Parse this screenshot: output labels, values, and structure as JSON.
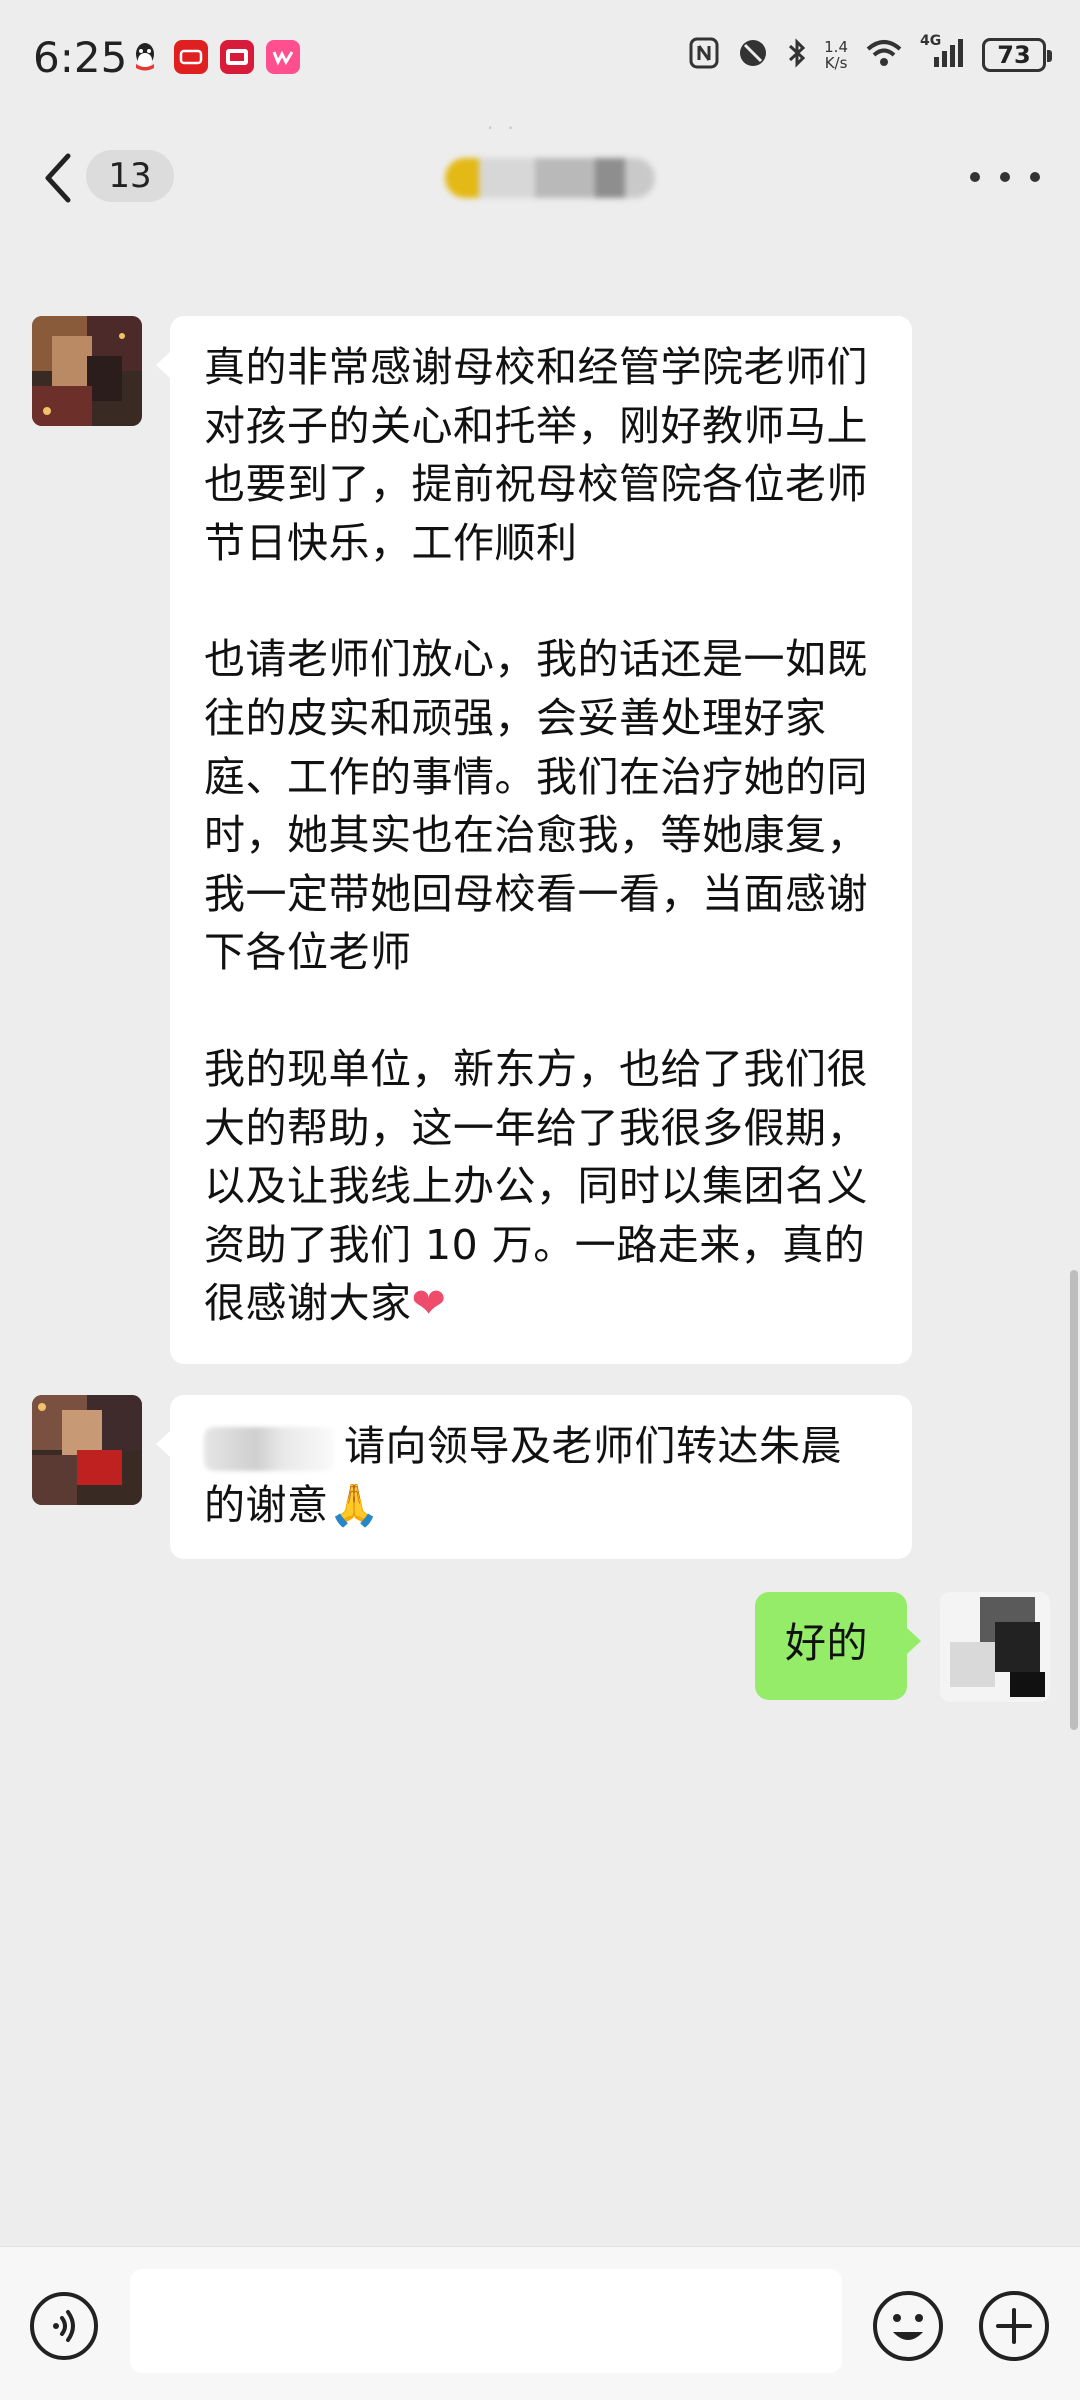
{
  "status_bar": {
    "time": "6:25",
    "network_speed_value": "1.4",
    "network_speed_unit": "K/s",
    "signal_label": "4G",
    "battery": "73"
  },
  "nav": {
    "unread_count": "13",
    "title": ""
  },
  "messages": [
    {
      "side": "left",
      "paragraphs": [
        "真的非常感谢母校和经管学院老师们对孩子的关心和托举，刚好教师马上也要到了，提前祝母校管院各位老师节日快乐，工作顺利",
        "也请老师们放心，我的话还是一如既往的皮实和顽强，会妥善处理好家庭、工作的事情。我们在治疗她的同时，她其实也在治愈我，等她康复，我一定带她回母校看一看，当面感谢下各位老师",
        "我的现单位，新东方，也给了我们很大的帮助，这一年给了我很多假期，以及让我线上办公，同时以集团名义资助了我们 10 万。一路走来，真的很感谢大家"
      ],
      "emoji": "❤"
    },
    {
      "side": "left",
      "text": "请向领导及老师们转达朱晨的谢意",
      "emoji": "🙏"
    },
    {
      "side": "right",
      "text": "好的"
    }
  ],
  "input": {
    "placeholder": "",
    "value": ""
  },
  "colors": {
    "background": "#ededed",
    "incoming_bubble": "#ffffff",
    "outgoing_bubble": "#95ec69",
    "input_bar": "#f7f7f7"
  },
  "icons": {
    "back": "chevron-left-icon",
    "more": "more-dots-icon",
    "voice": "voice-icon",
    "emoji": "emoji-icon",
    "plus": "plus-icon"
  }
}
